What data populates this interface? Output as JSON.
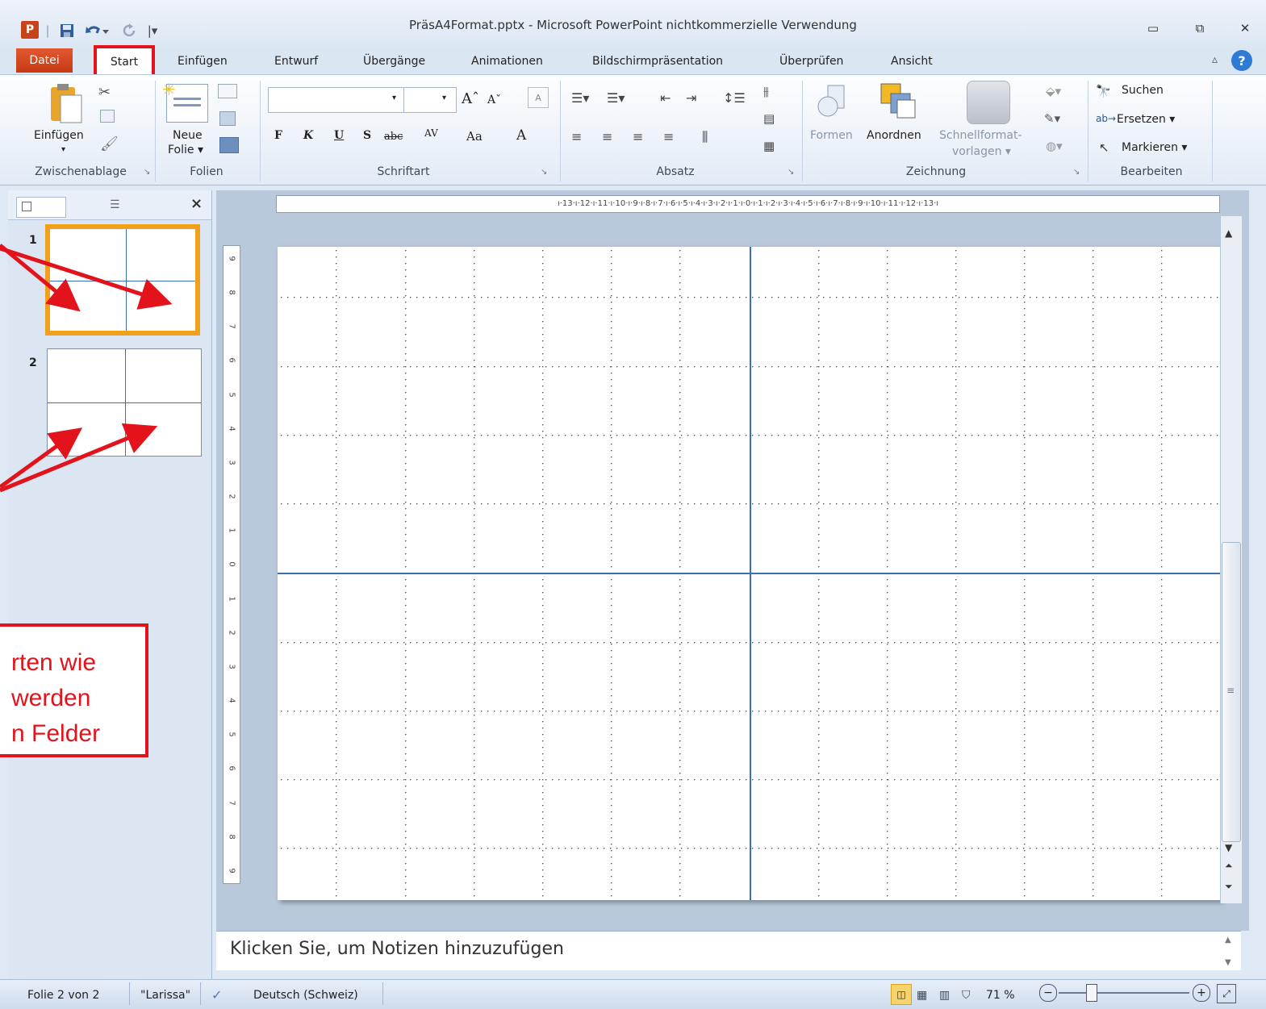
{
  "window": {
    "title": "PräsA4Format.pptx - Microsoft PowerPoint nichtkommerzielle Verwendung",
    "controls": [
      "minimize-icon",
      "restore-icon",
      "close-icon"
    ]
  },
  "qat": {
    "app_icon": "P",
    "items": [
      "save-icon",
      "undo-icon",
      "redo-icon",
      "customize-icon"
    ]
  },
  "tabs": {
    "datei": "Datei",
    "start": "Start",
    "einfuegen": "Einfügen",
    "entwurf": "Entwurf",
    "uebergaenge": "Übergänge",
    "animationen": "Animationen",
    "bildschirm": "Bildschirmpräsentation",
    "ueberpruefen": "Überprüfen",
    "ansicht": "Ansicht"
  },
  "ribbon": {
    "clipboard": {
      "label": "Zwischenablage",
      "paste": "Einfügen"
    },
    "slides": {
      "label": "Folien",
      "new_slide_1": "Neue",
      "new_slide_2": "Folie ▾"
    },
    "font": {
      "label": "Schriftart",
      "bold": "F",
      "italic": "K",
      "underline": "U",
      "shadow": "S",
      "strike": "abc",
      "spacing": "AV",
      "case": "Aa",
      "color": "A"
    },
    "paragraph": {
      "label": "Absatz"
    },
    "drawing": {
      "label": "Zeichnung",
      "shapes": "Formen",
      "arrange": "Anordnen",
      "quickstyles_1": "Schnellformat-",
      "quickstyles_2": "vorlagen ▾"
    },
    "editing": {
      "label": "Bearbeiten",
      "find": "Suchen",
      "replace": "Ersetzen ▾",
      "select": "Markieren ▾"
    }
  },
  "slide_panel": {
    "close": "×",
    "thumbs": [
      {
        "number": "1"
      },
      {
        "number": "2"
      }
    ]
  },
  "rulers": {
    "horizontal": "ı·13·ı·12·ı·11·ı·10·ı·9·ı·8·ı·7·ı·6·ı·5·ı·4·ı·3·ı·2·ı·1·ı·0·ı·1·ı·2·ı·3·ı·4·ı·5·ı·6·ı·7·ı·8·ı·9·ı·10·ı·11·ı·12·ı·13·ı",
    "vertical": [
      "9",
      "8",
      "7",
      "6",
      "5",
      "4",
      "3",
      "2",
      "1",
      "0",
      "1",
      "2",
      "3",
      "4",
      "5",
      "6",
      "7",
      "8",
      "9"
    ]
  },
  "notes": {
    "placeholder": "Klicken Sie, um Notizen hinzuzufügen"
  },
  "status": {
    "slide": "Folie 2 von 2",
    "theme": "\"Larissa\"",
    "language": "Deutsch (Schweiz)",
    "zoom": "71 %"
  },
  "annotation": {
    "lines": [
      "rten wie",
      "werden",
      "n Felder"
    ]
  },
  "colors": {
    "annotation_red": "#e3131b",
    "selected_thumb": "#f0a01a",
    "guide_blue": "#3a6fb6"
  }
}
